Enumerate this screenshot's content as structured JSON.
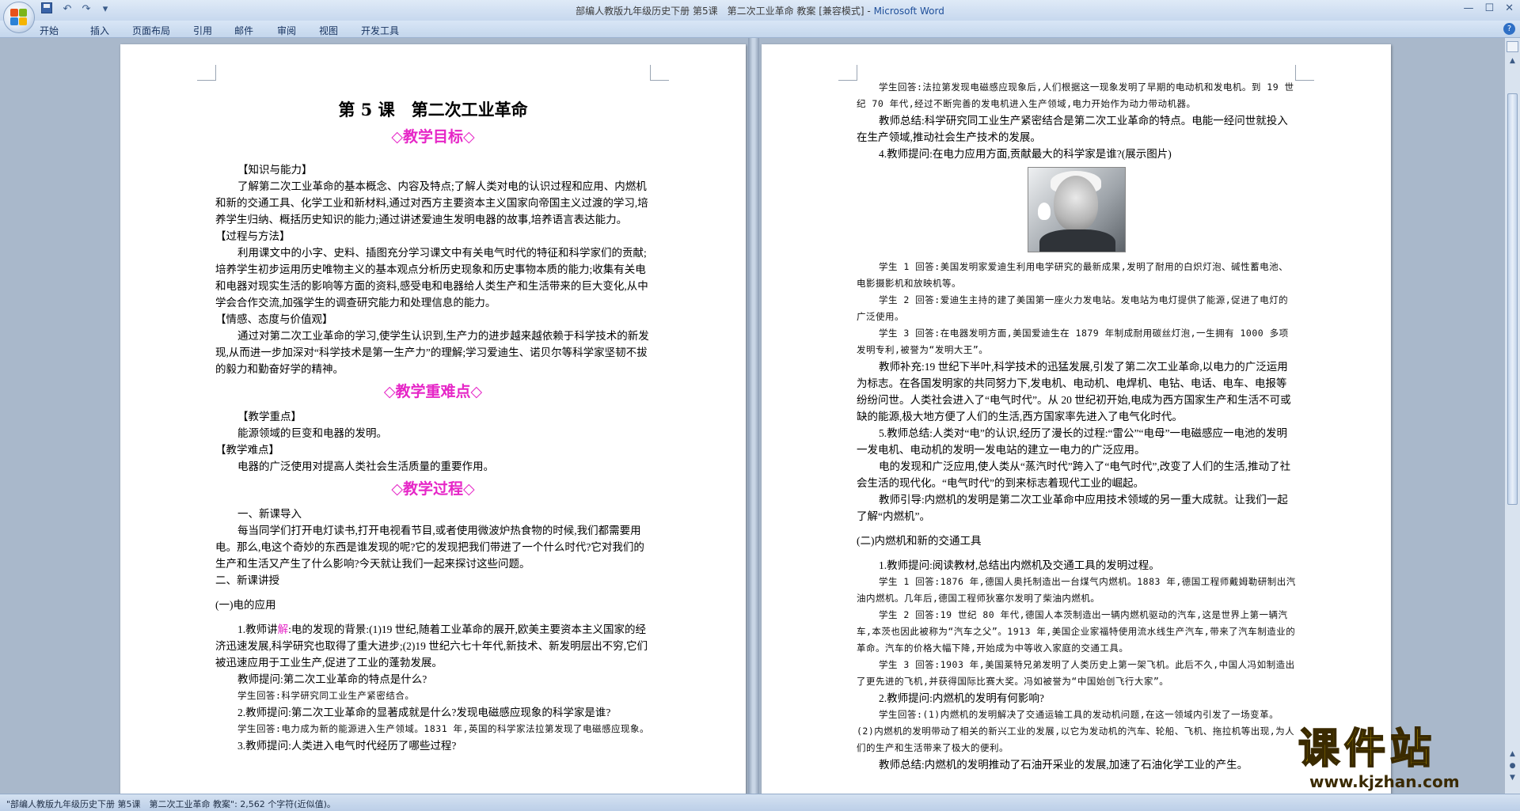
{
  "window": {
    "title": "部编人教版九年级历史下册 第5课　第二次工业革命  教案 [兼容模式]",
    "app_name": "Microsoft Word"
  },
  "ribbon": {
    "tabs": [
      "开始",
      "插入",
      "页面布局",
      "引用",
      "邮件",
      "审阅",
      "视图",
      "开发工具"
    ]
  },
  "left_page": {
    "title": "第 5 课　第二次工业革命",
    "sections": {
      "goals": "◇教学目标◇",
      "key_points": "◇教学重难点◇",
      "process": "◇教学过程◇"
    },
    "lines": {
      "k_heading": "【知识与能力】",
      "k_text": "了解第二次工业革命的基本概念、内容及特点;了解人类对电的认识过程和应用、内燃机和新的交通工具、化学工业和新材料,通过对西方主要资本主义国家向帝国主义过渡的学习,培养学生归纳、概括历史知识的能力;通过讲述爱迪生发明电器的故事,培养语言表达能力。",
      "m_heading": "【过程与方法】",
      "m_text": "利用课文中的小字、史料、插图充分学习课文中有关电气时代的特征和科学家们的贡献;培养学生初步运用历史唯物主义的基本观点分析历史现象和历史事物本质的能力;收集有关电和电器对现实生活的影响等方面的资料,感受电和电器给人类生产和生活带来的巨大变化,从中学会合作交流,加强学生的调查研究能力和处理信息的能力。",
      "e_heading": "【情感、态度与价值观】",
      "e_text": "通过对第二次工业革命的学习,使学生认识到,生产力的进步越来越依赖于科学技术的新发现,从而进一步加深对“科学技术是第一生产力”的理解;学习爱迪生、诺贝尔等科学家坚韧不拔的毅力和勤奋好学的精神。",
      "kp_heading": "【教学重点】",
      "kp_text": "能源领域的巨变和电器的发明。",
      "kd_heading": "【教学难点】",
      "kd_text": "电器的广泛使用对提高人类社会生活质量的重要作用。",
      "intro_heading": "一、新课导入",
      "intro_text": "每当同学们打开电灯读书,打开电视看节目,或者使用微波炉热食物的时候,我们都需要用电。那么,电这个奇妙的东西是谁发现的呢?它的发现把我们带进了一个什么时代?它对我们的生产和生活又产生了什么影响?今天就让我们一起来探讨这些问题。",
      "new_heading": "二、新课讲授",
      "sub1": "(一)电的应用",
      "t1_pre": "1.教师讲",
      "t1_hl": "解",
      "t1_post": ":电的发现的背景:(1)19 世纪,随着工业革命的展开,欧美主要资本主义国家的经济迅速发展,科学研究也取得了重大进步;(2)19 世纪六七十年代,新技术、新发明层出不穷,它们被迅速应用于工业生产,促进了工业的蓬勃发展。",
      "q1": "教师提问:第二次工业革命的特点是什么?",
      "a1": "学生回答:科学研究同工业生产紧密结合。",
      "q2": "2.教师提问:第二次工业革命的显著成就是什么?发现电磁感应现象的科学家是谁?",
      "a2": "学生回答:电力成为新的能源进入生产领域。1831 年,英国的科学家法拉第发现了电磁感应现象。",
      "q3": "3.教师提问:人类进入电气时代经历了哪些过程?"
    }
  },
  "right_page": {
    "lines": {
      "r1": "学生回答:法拉第发现电磁感应现象后,人们根据这一现象发明了早期的电动机和发电机。到 19 世纪 70 年代,经过不断完善的发电机进入生产领域,电力开始作为动力带动机器。",
      "r2": "教师总结:科学研究同工业生产紧密结合是第二次工业革命的特点。电能一经问世就投入在生产领域,推动社会生产技术的发展。",
      "r3": "4.教师提问:在电力应用方面,贡献最大的科学家是谁?(展示图片)",
      "r4": "学生 1 回答:美国发明家爱迪生利用电学研究的最新成果,发明了耐用的白炽灯泡、碱性蓄电池、电影摄影机和放映机等。",
      "r5": "学生 2 回答:爱迪生主持的建了美国第一座火力发电站。发电站为电灯提供了能源,促进了电灯的广泛使用。",
      "r6": "学生 3 回答:在电器发明方面,美国爱迪生在 1879 年制成耐用碳丝灯泡,一生拥有 1000 多项发明专利,被誉为“发明大王”。",
      "r7": "教师补充:19 世纪下半叶,科学技术的迅猛发展,引发了第二次工业革命,以电力的广泛运用为标志。在各国发明家的共同努力下,发电机、电动机、电焊机、电钻、电话、电车、电报等纷纷问世。人类社会进入了“电气时代”。从 20 世纪初开始,电成为西方国家生产和生活不可或缺的能源,极大地方便了人们的生活,西方国家率先进入了电气化时代。",
      "r8": "5.教师总结:人类对“电”的认识,经历了漫长的过程:“雷公”“电母”一电磁感应一电池的发明一发电机、电动机的发明一发电站的建立一电力的广泛应用。",
      "r9": "电的发现和广泛应用,使人类从“蒸汽时代”跨入了“电气时代”,改变了人们的生活,推动了社会生活的现代化。“电气时代”的到来标志着现代工业的崛起。",
      "r10": "教师引导:内燃机的发明是第二次工业革命中应用技术领域的另一重大成就。让我们一起了解“内燃机”。",
      "r11": "(二)内燃机和新的交通工具",
      "r12": "1.教师提问:阅读教材,总结出内燃机及交通工具的发明过程。",
      "r13": "学生 1 回答:1876 年,德国人奥托制造出一台煤气内燃机。1883 年,德国工程师戴姆勒研制出汽油内燃机。几年后,德国工程师狄塞尔发明了柴油内燃机。",
      "r14": "学生 2 回答:19 世纪 80 年代,德国人本茨制造出一辆内燃机驱动的汽车,这是世界上第一辆汽车,本茨也因此被称为“汽车之父”。1913 年,美国企业家福特使用流水线生产汽车,带来了汽车制造业的革命。汽车的价格大幅下降,开始成为中等收入家庭的交通工具。",
      "r15": "学生 3 回答:1903 年,美国莱特兄弟发明了人类历史上第一架飞机。此后不久,中国人冯如制造出了更先进的飞机,并获得国际比赛大奖。冯如被誉为“中国始创飞行大家”。",
      "r16": "2.教师提问:内燃机的发明有何影响?",
      "r17": "学生回答:(1)内燃机的发明解决了交通运输工具的发动机问题,在这一领域内引发了一场变革。(2)内燃机的发明带动了相关的新兴工业的发展,以它为发动机的汽车、轮船、飞机、拖拉机等出现,为人们的生产和生活带来了极大的便利。",
      "r18": "教师总结:内燃机的发明推动了石油开采业的发展,加速了石油化学工业的产生。"
    }
  },
  "statusbar": {
    "text": "\"部编人教版九年级历史下册 第5课　第二次工业革命  教案\": 2,562 个字符(近似值)。"
  },
  "watermark": {
    "big": "课件站",
    "url": "www.kjzhan.com"
  }
}
